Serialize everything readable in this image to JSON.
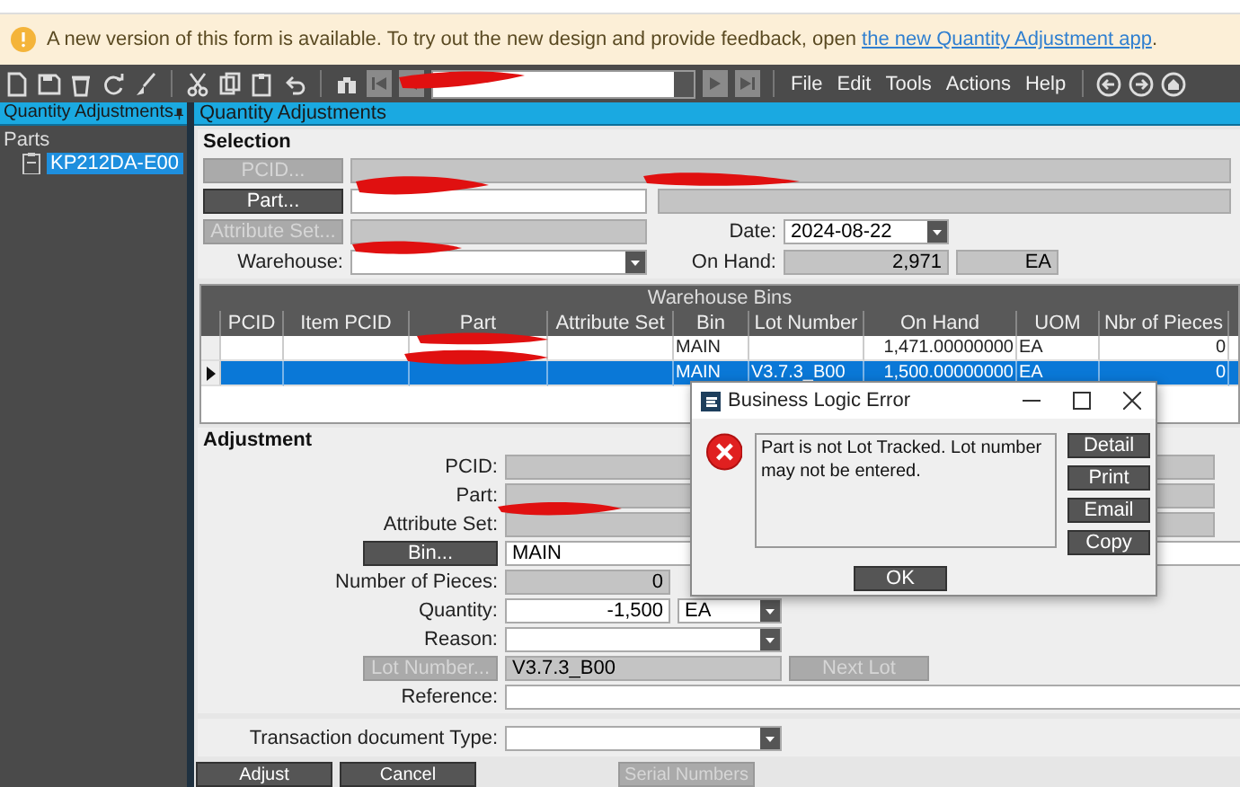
{
  "banner": {
    "text": "A new version of this form is available. To try out the new design and provide feedback, open ",
    "link": "the new Quantity Adjustment app",
    "after": "."
  },
  "toolbar": {
    "menus": [
      "File",
      "Edit",
      "Tools",
      "Actions",
      "Help"
    ]
  },
  "tree": {
    "title": "Quantity Adjustments",
    "items": [
      {
        "label": "Parts",
        "children": [
          {
            "label": "KP212DA-E00",
            "selected": true
          }
        ]
      }
    ]
  },
  "form": {
    "title": "Quantity Adjustments"
  },
  "selection": {
    "title": "Selection",
    "buttons": [
      {
        "label": "PCID...",
        "disabled": true
      },
      {
        "label": "Part...",
        "disabled": false
      },
      {
        "label": "Attribute Set...",
        "disabled": true
      }
    ],
    "warehouse_label": "Warehouse:",
    "date_label": "Date:",
    "date": "2024-08-22",
    "on_hand_label": "On Hand:",
    "on_hand": "2,971",
    "on_hand_uom": "EA"
  },
  "bins": {
    "title": "Warehouse Bins",
    "columns": [
      "PCID",
      "Item PCID",
      "Part",
      "Attribute Set",
      "Bin",
      "Lot Number",
      "On Hand",
      "UOM",
      "Nbr of Pieces"
    ],
    "rows": [
      {
        "selected": false,
        "cells": [
          "",
          "",
          "",
          "",
          "MAIN",
          "",
          "1,471.00000000",
          "EA",
          "0"
        ]
      },
      {
        "selected": true,
        "cells": [
          "",
          "",
          "",
          "",
          "MAIN",
          "V3.7.3_B00",
          "1,500.00000000",
          "EA",
          "0"
        ]
      }
    ]
  },
  "adjustment": {
    "title": "Adjustment",
    "rows": [
      {
        "kind": "readonly",
        "label": "PCID:"
      },
      {
        "kind": "readonly",
        "label": "Part:"
      },
      {
        "kind": "readonly",
        "label": "Attribute Set:"
      },
      {
        "kind": "button",
        "button": "Bin...",
        "disabled": false,
        "value": "MAIN"
      },
      {
        "kind": "number",
        "label": "Number of Pieces:",
        "value": "0"
      },
      {
        "kind": "quantity",
        "label": "Quantity:",
        "value": "-1,500",
        "uom": "EA"
      },
      {
        "kind": "combo",
        "label": "Reason:"
      },
      {
        "kind": "lot",
        "button": "Lot Number...",
        "disabled": true,
        "value": "V3.7.3_B00",
        "extra_button": "Next Lot",
        "extra_disabled": true
      },
      {
        "kind": "input",
        "label": "Reference:"
      }
    ],
    "transaction_label": "Transaction document Type:"
  },
  "actions": [
    {
      "label": "Adjust",
      "disabled": false
    },
    {
      "label": "Cancel",
      "disabled": false
    },
    {
      "label": "Serial Numbers",
      "disabled": true
    }
  ],
  "dialog": {
    "title": "Business Logic Error",
    "message": "Part is not Lot Tracked. Lot number may not be entered.",
    "buttons": [
      "Detail",
      "Print",
      "Email",
      "Copy"
    ],
    "ok": "OK"
  }
}
